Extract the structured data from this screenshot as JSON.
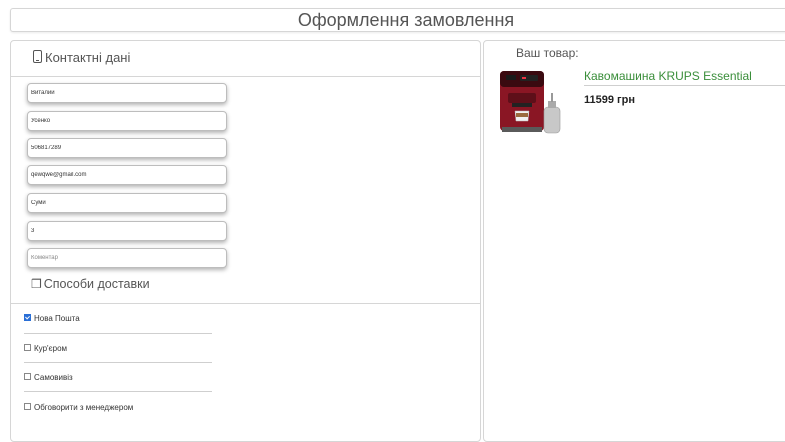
{
  "header": {
    "title": "Оформлення замовлення"
  },
  "contact": {
    "heading": "Контактні дані",
    "fields": [
      {
        "value": "Виталий",
        "placeholder": ""
      },
      {
        "value": "Усенко",
        "placeholder": ""
      },
      {
        "value": "506817289",
        "placeholder": ""
      },
      {
        "value": "qewqwe@gmail.com",
        "placeholder": ""
      },
      {
        "value": "Суми",
        "placeholder": ""
      },
      {
        "value": "3",
        "placeholder": ""
      },
      {
        "value": "",
        "placeholder": "Коментар"
      }
    ]
  },
  "delivery": {
    "heading": "Способи доставки",
    "options": [
      {
        "label": "Нова Пошта",
        "checked": true
      },
      {
        "label": "Кур'єром",
        "checked": false
      },
      {
        "label": "Самовивіз",
        "checked": false
      },
      {
        "label": "Обговорити з менеджером",
        "checked": false
      }
    ]
  },
  "product": {
    "heading": "Ваш товар:",
    "name": "Кавомашина KRUPS Essential",
    "price": "11599 грн"
  },
  "colors": {
    "product_name": "#3a8e3a",
    "checkbox_checked": "#2a6fd6",
    "border": "#d6d6d6"
  },
  "icons": {
    "contact": "phone-icon",
    "delivery": "package-icon",
    "checkbox": "checkbox-icon"
  }
}
